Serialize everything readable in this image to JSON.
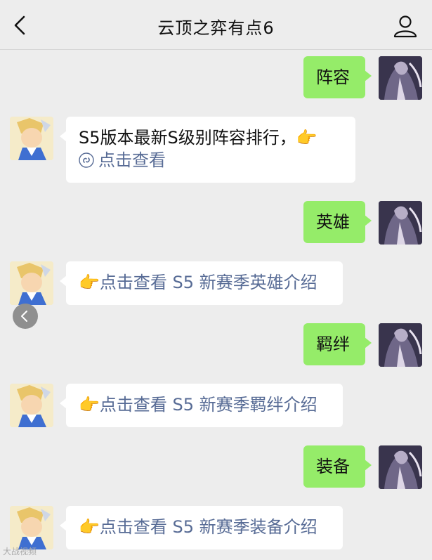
{
  "header": {
    "title": "云顶之弈有点6"
  },
  "messages": [
    {
      "side": "me",
      "text": "阵容"
    },
    {
      "side": "bot",
      "text": "S5版本最新S级别阵容排行，👉",
      "link": "点击查看"
    },
    {
      "side": "me",
      "text": "英雄"
    },
    {
      "side": "bot",
      "link": "👉点击查看 S5 新赛季英雄介绍"
    },
    {
      "side": "me",
      "text": "羁绊"
    },
    {
      "side": "bot",
      "link": "👉点击查看 S5 新赛季羁绊介绍"
    },
    {
      "side": "me",
      "text": "装备"
    },
    {
      "side": "bot",
      "link": "👉点击查看 S5 新赛季装备介绍"
    }
  ],
  "icons": {
    "back": "chevron-left-icon",
    "profile": "person-icon",
    "mini_program": "mini-program-link-icon"
  },
  "colors": {
    "my_bubble": "#95ec69",
    "bot_bubble": "#ffffff",
    "link": "#576b95",
    "background": "#ededed"
  },
  "watermark": "大战视频"
}
